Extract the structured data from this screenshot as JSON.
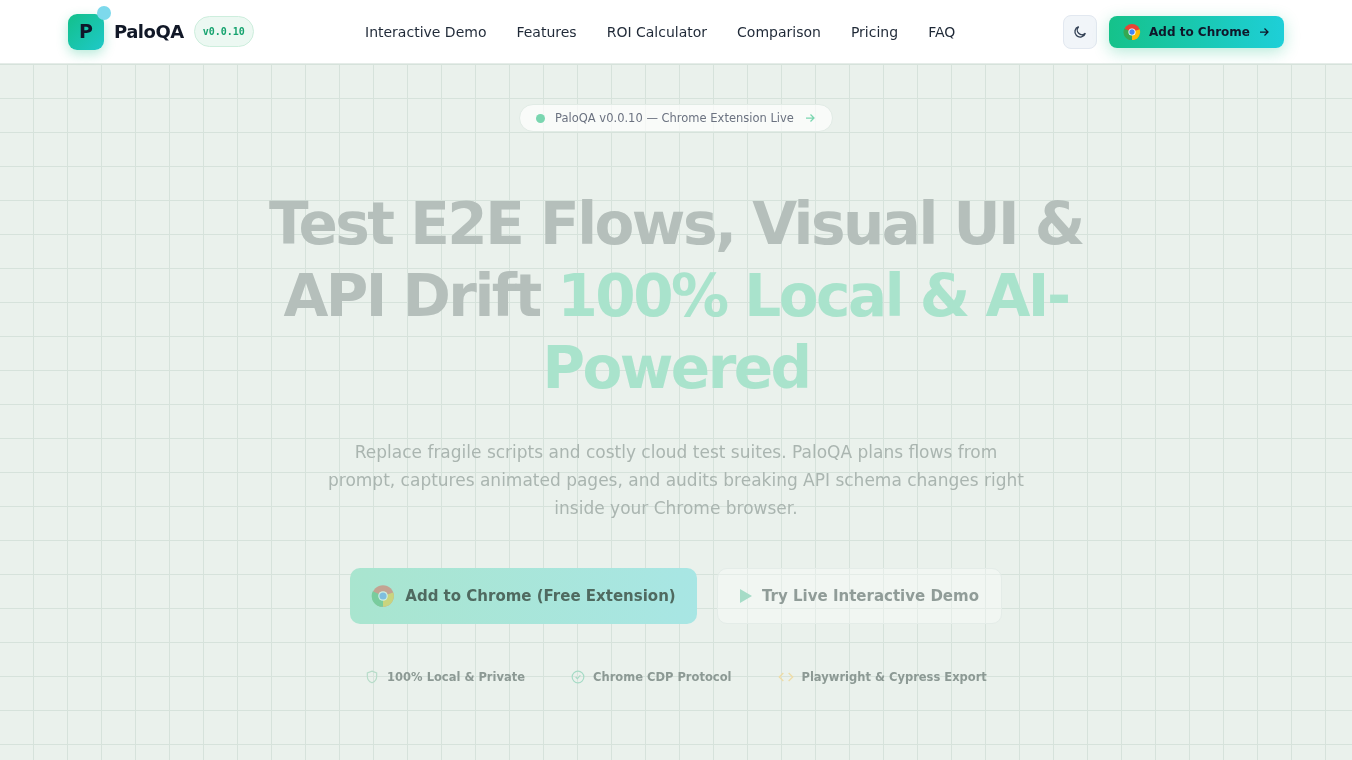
{
  "brand": {
    "logo_letter": "P",
    "name": "PaloQA",
    "version": "v0.0.10"
  },
  "nav": [
    {
      "label": "Interactive Demo"
    },
    {
      "label": "Features"
    },
    {
      "label": "ROI Calculator"
    },
    {
      "label": "Comparison"
    },
    {
      "label": "Pricing"
    },
    {
      "label": "FAQ"
    }
  ],
  "header_cta": {
    "label": "Add to Chrome"
  },
  "announcement": {
    "label": "PaloQA v0.0.10 — Chrome Extension Live"
  },
  "headline": {
    "lead": "Test E2E Flows, Visual UI & API Drift",
    "accent": "100% Local & AI-Powered"
  },
  "subtitle": "Replace fragile scripts and costly cloud test suites. PaloQA plans flows from prompt, captures animated pages, and audits breaking API schema changes right inside your Chrome browser.",
  "actions": [
    {
      "kind": "primary",
      "label": "Add to Chrome (Free Extension)"
    },
    {
      "kind": "secondary",
      "label": "Try Live Interactive Demo"
    }
  ],
  "features": [
    {
      "kind": "shield",
      "label": "100% Local & Private"
    },
    {
      "kind": "check",
      "label": "Chrome CDP Protocol"
    },
    {
      "kind": "code",
      "label": "Playwright & Cypress Export"
    }
  ]
}
